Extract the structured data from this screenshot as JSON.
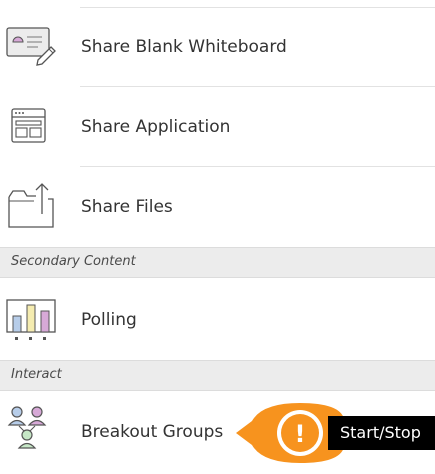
{
  "menu": {
    "items": [
      {
        "label": "Share Blank Whiteboard",
        "icon": "whiteboard-icon"
      },
      {
        "label": "Share Application",
        "icon": "application-window-icon"
      },
      {
        "label": "Share Files",
        "icon": "folder-upload-icon"
      }
    ],
    "sections": [
      {
        "title": "Secondary Content",
        "items": [
          {
            "label": "Polling",
            "icon": "polling-chart-icon"
          }
        ]
      },
      {
        "title": "Interact",
        "items": [
          {
            "label": "Breakout Groups",
            "icon": "breakout-groups-icon"
          }
        ]
      }
    ]
  },
  "callout": {
    "alert_symbol": "!",
    "tooltip_text": "Start/Stop",
    "colors": {
      "accent": "#f7931e",
      "tooltip_bg": "#000000",
      "tooltip_text": "#ffffff"
    }
  }
}
